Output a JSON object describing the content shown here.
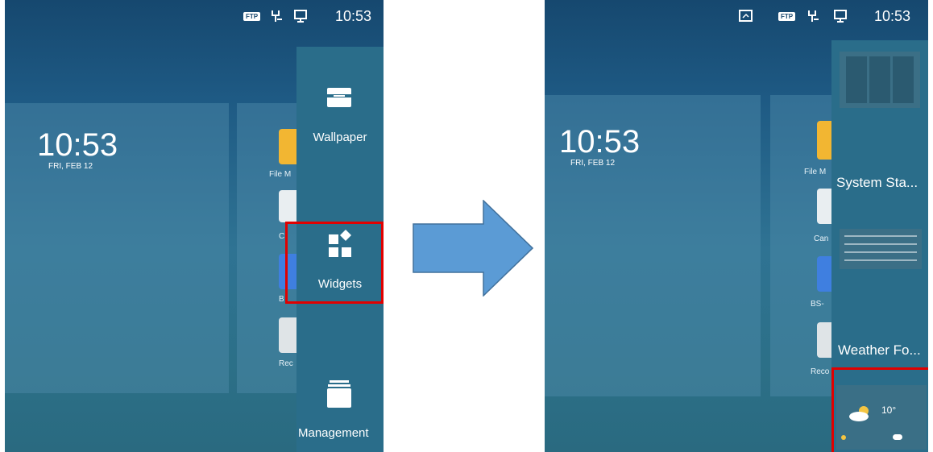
{
  "left": {
    "status": {
      "ftp_badge": "FTP",
      "time": "10:53"
    },
    "clock": {
      "time": "10:53",
      "date": "FRI, FEB 12"
    },
    "apps": [
      "File M",
      "C",
      "B",
      "Rec"
    ],
    "menu": {
      "wallpaper_label": "Wallpaper",
      "widgets_label": "Widgets",
      "management_label": "Management"
    }
  },
  "right": {
    "status": {
      "ftp_badge": "FTP",
      "time": "10:53"
    },
    "clock": {
      "time": "10:53",
      "date": "FRI, FEB 12"
    },
    "apps": [
      "File M",
      "Can",
      "BS-",
      "Reco"
    ],
    "widgets": {
      "system_status_title": "System Sta...",
      "weather_title": "Weather Fo...",
      "weather_temp": "10°"
    }
  },
  "colors": {
    "highlight": "#e00000",
    "arrow": "#5b9bd5"
  }
}
